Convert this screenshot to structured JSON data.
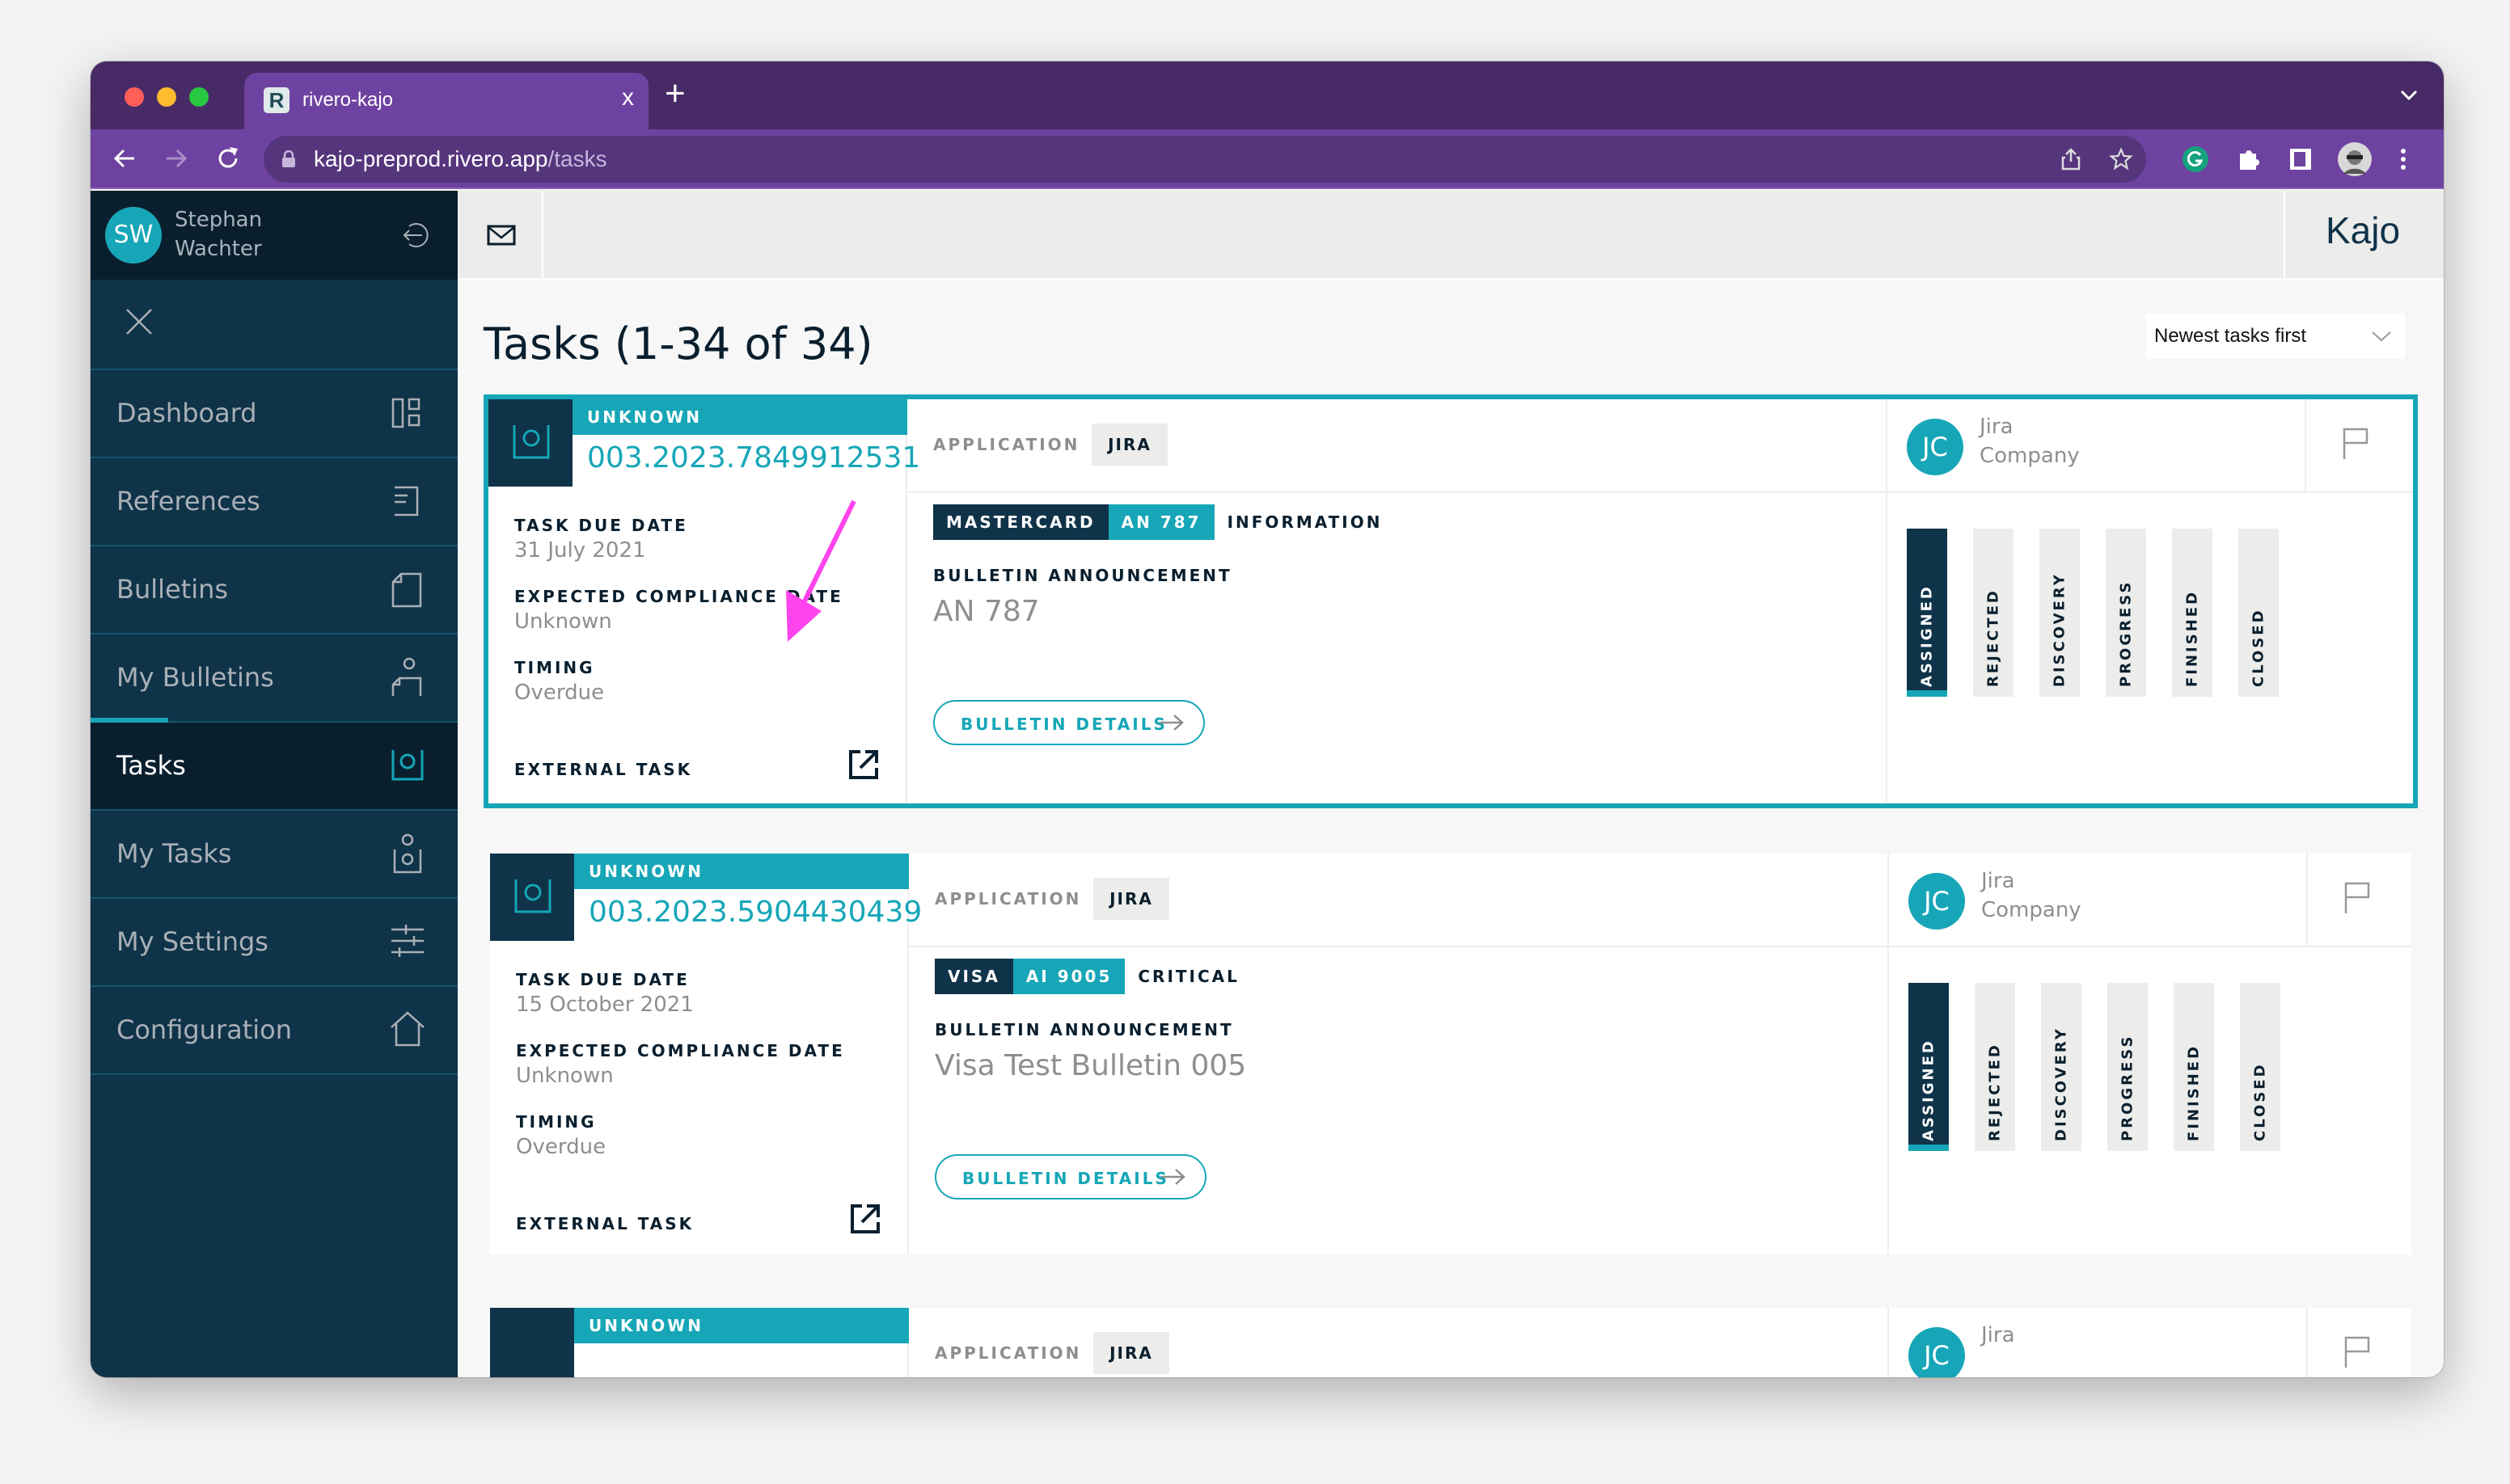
{
  "browser": {
    "tab_title": "rivero-kajo",
    "tab_close": "x",
    "new_tab": "+",
    "url_host": "kajo-preprod.rivero.app",
    "url_path": "/tasks",
    "status_url": "https://kajo-preprod.rivero.app/task/56b607ef-1a51-49fb-bde6-ffed5bf560ad"
  },
  "user": {
    "initials": "SW",
    "first_name": "Stephan",
    "last_name": "Wachter"
  },
  "sidebar": {
    "items": [
      {
        "label": "Dashboard",
        "icon": "dashboard-icon"
      },
      {
        "label": "References",
        "icon": "references-icon"
      },
      {
        "label": "Bulletins",
        "icon": "bulletins-icon"
      },
      {
        "label": "My Bulletins",
        "icon": "my-bulletins-icon"
      },
      {
        "label": "Tasks",
        "icon": "tasks-icon",
        "active": true
      },
      {
        "label": "My Tasks",
        "icon": "my-tasks-icon"
      },
      {
        "label": "My Settings",
        "icon": "sliders-icon"
      },
      {
        "label": "Configuration",
        "icon": "home-icon"
      }
    ]
  },
  "header": {
    "brand": "Kajo"
  },
  "main": {
    "title": "Tasks (1-34 of 34)",
    "sort": {
      "selected": "Newest tasks first"
    }
  },
  "labels": {
    "task_due_date": "TASK DUE DATE",
    "expected_compliance_date": "EXPECTED COMPLIANCE DATE",
    "timing": "TIMING",
    "external_task": "EXTERNAL TASK",
    "application": "APPLICATION",
    "bulletin_announcement": "BULLETIN ANNOUNCEMENT",
    "bulletin_details": "BULLETIN DETAILS"
  },
  "stages": [
    "ASSIGNED",
    "REJECTED",
    "DISCOVERY",
    "PROGRESS",
    "FINISHED",
    "CLOSED"
  ],
  "tasks": [
    {
      "status": "UNKNOWN",
      "id": "003.2023.7849912531",
      "due_date": "31 July 2021",
      "compliance_date": "Unknown",
      "timing": "Overdue",
      "application": "JIRA",
      "network": "MASTERCARD",
      "bulletin_code": "AN 787",
      "severity": "INFORMATION",
      "bulletin_title": "AN 787",
      "assignee_initials": "JC",
      "assignee_first": "Jira",
      "assignee_last": "Company",
      "current_stage": "ASSIGNED",
      "selected": true
    },
    {
      "status": "UNKNOWN",
      "id": "003.2023.5904430439",
      "due_date": "15 October 2021",
      "compliance_date": "Unknown",
      "timing": "Overdue",
      "application": "JIRA",
      "network": "VISA",
      "bulletin_code": "AI 9005",
      "severity": "CRITICAL",
      "bulletin_title": "Visa Test Bulletin 005",
      "assignee_initials": "JC",
      "assignee_first": "Jira",
      "assignee_last": "Company",
      "current_stage": "ASSIGNED"
    },
    {
      "status": "UNKNOWN",
      "application": "JIRA",
      "assignee_initials": "JC",
      "assignee_first": "Jira"
    }
  ],
  "colors": {
    "accent_teal": "#16a6b7",
    "navy": "#0f3349",
    "navy_dark": "#0a1f2e",
    "browser_purple": "#6e42a0",
    "annotation_magenta": "#ff44ee"
  }
}
